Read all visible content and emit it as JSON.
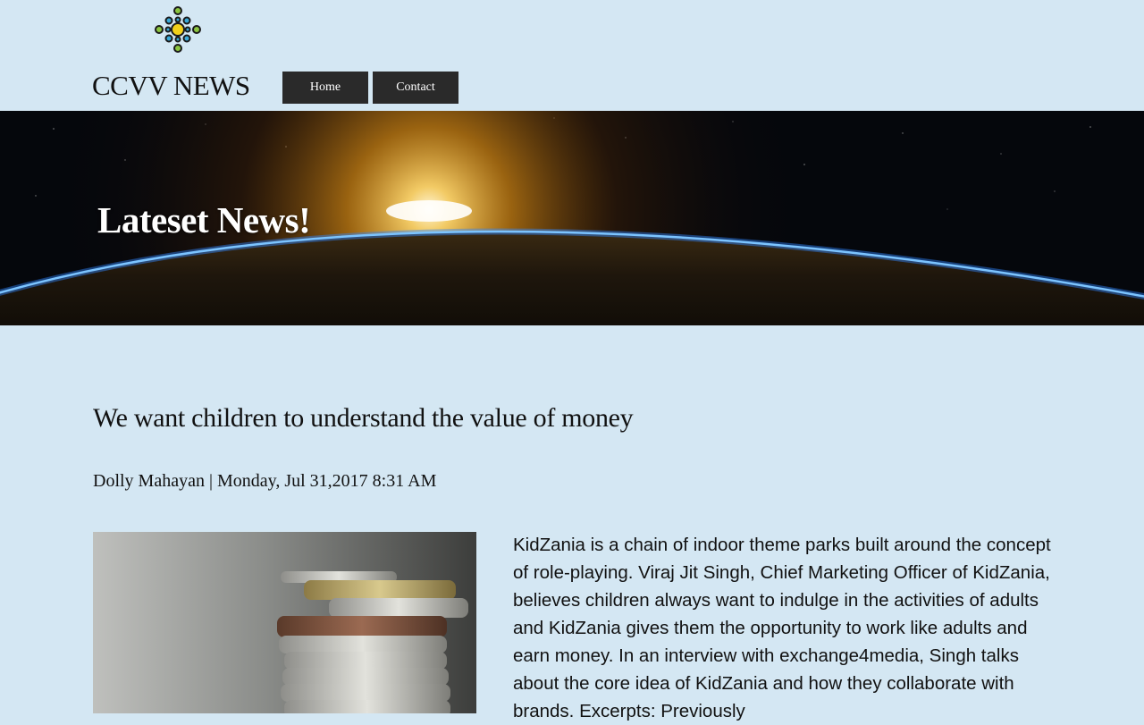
{
  "header": {
    "site_title": "CCVV NEWS",
    "logo_icon": "network-dots-logo",
    "nav": [
      {
        "label": "Home"
      },
      {
        "label": "Contact"
      }
    ]
  },
  "hero": {
    "title": "Lateset News!",
    "image": "earth-sunrise-from-space"
  },
  "article": {
    "title": "We want children to understand the value of money",
    "byline": "Dolly Mahayan | Monday, Jul 31,2017 8:31 AM",
    "image": "stacked-coins-photo",
    "body": "KidZania is a chain of indoor theme parks built around the concept of role-playing. Viraj Jit Singh, Chief Marketing Officer of KidZania, believes children always want to indulge in the activities of adults and KidZania gives them the opportunity to work like adults and earn money. In an interview with exchange4media, Singh talks about the core idea of KidZania and how they collaborate with brands. Excerpts: Previously"
  },
  "colors": {
    "background": "#d4e7f3",
    "nav_button": "#2a2a2a",
    "logo_yellow": "#f2d01a",
    "logo_blue": "#3aa9d8",
    "logo_green": "#8bc53f"
  }
}
